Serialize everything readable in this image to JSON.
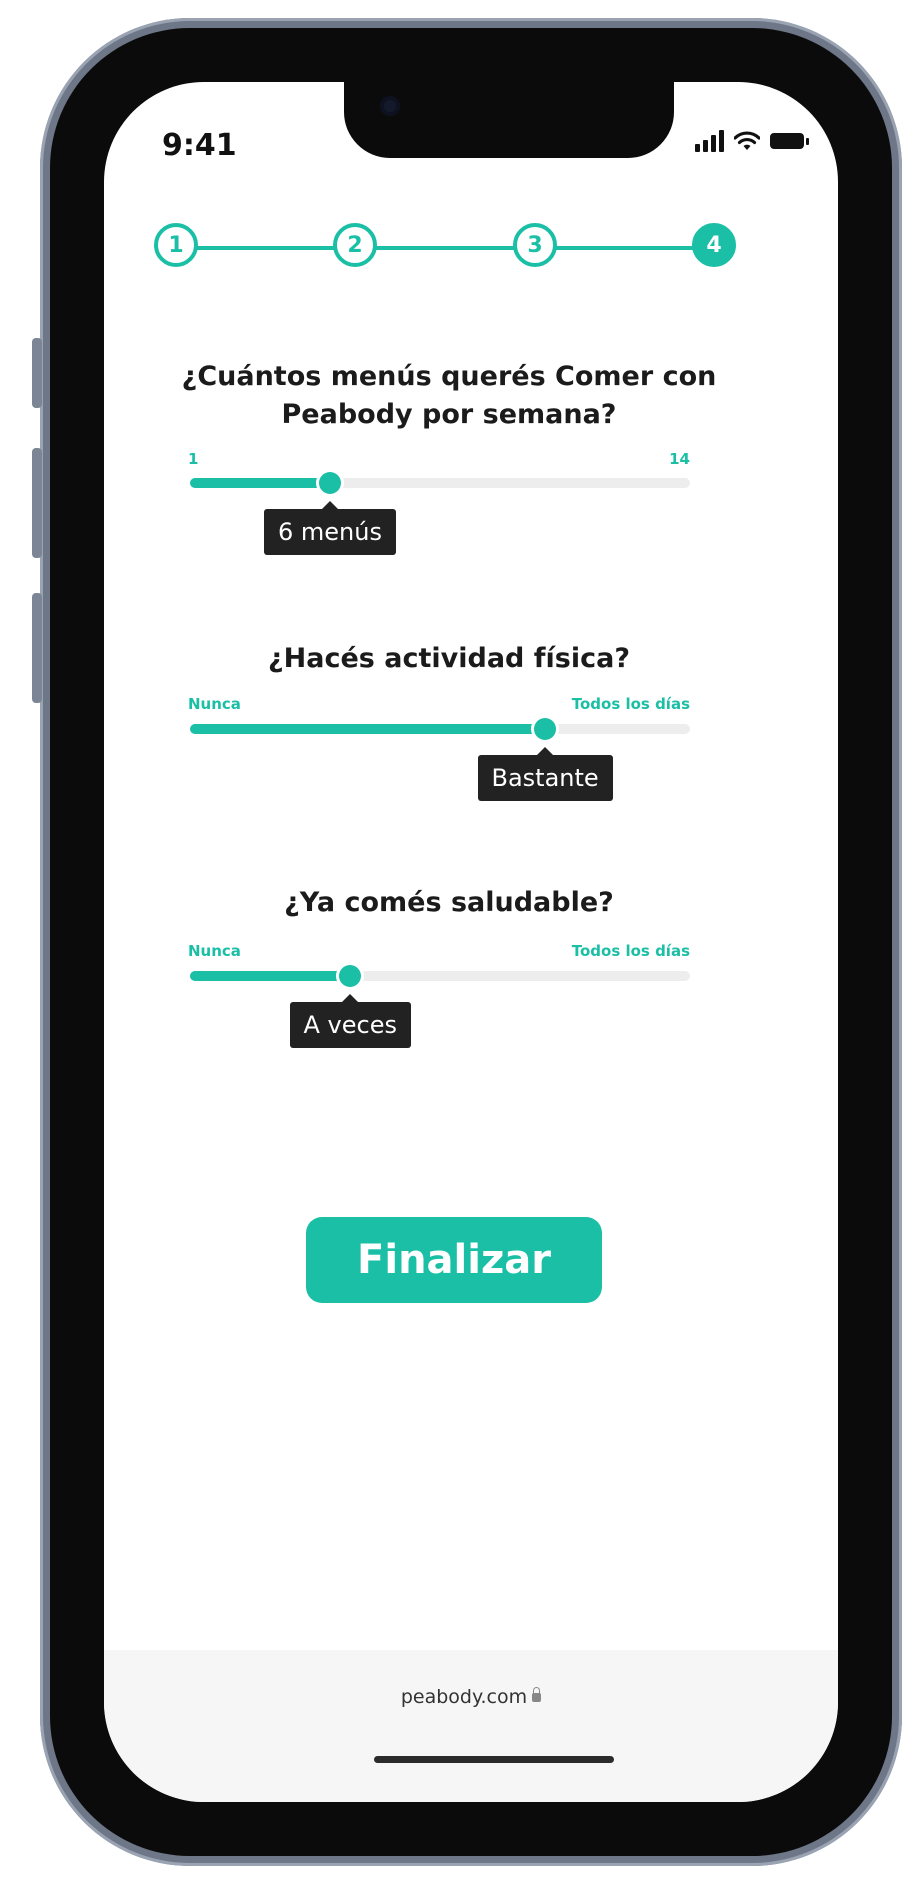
{
  "status": {
    "time": "9:41"
  },
  "stepper": {
    "steps": [
      "1",
      "2",
      "3",
      "4"
    ],
    "active_step": 4
  },
  "questions": [
    {
      "question": "¿Cuántos menús querés Comer con Peabody por semana?",
      "min_label": "1",
      "max_label": "14",
      "value_label": "6 menús",
      "fill_percent": 28
    },
    {
      "question": "¿Hacés actividad física?",
      "min_label": "Nunca",
      "max_label": "Todos los días",
      "value_label": "Bastante",
      "fill_percent": 71
    },
    {
      "question": "¿Ya comés saludable?",
      "min_label": "Nunca",
      "max_label": "Todos los días",
      "value_label": "A veces",
      "fill_percent": 32
    }
  ],
  "finish_button": {
    "label": "Finalizar"
  },
  "browser": {
    "url": "peabody.com"
  },
  "colors": {
    "accent": "#1bbfa6",
    "tooltip": "#222222"
  }
}
